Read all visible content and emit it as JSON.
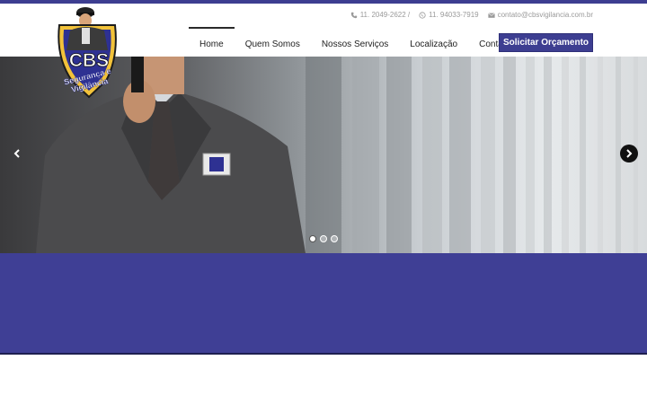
{
  "logo": {
    "brand": "CBS",
    "tagline_1": "Segurança e",
    "tagline_2": "Vigilância"
  },
  "contact": {
    "phone_icon": "phone-icon",
    "phone": "11. 2049-2622 /",
    "whatsapp_icon": "whatsapp-icon",
    "whatsapp": "11. 94033-7919",
    "email_icon": "envelope-icon",
    "email": "contato@cbsvigilancia.com.br"
  },
  "nav": {
    "items": [
      {
        "label": "Home",
        "active": true
      },
      {
        "label": "Quem Somos",
        "active": false
      },
      {
        "label": "Nossos Serviços",
        "active": false
      },
      {
        "label": "Localização",
        "active": false
      },
      {
        "label": "Contato",
        "active": false
      }
    ]
  },
  "cta": {
    "label": "Solicitar Orçamento"
  },
  "hero": {
    "prev_icon": "chevron-left-icon",
    "next_icon": "chevron-right-icon",
    "slide_count": 3,
    "active_slide": 1
  },
  "colors": {
    "brand": "#3d3e91",
    "band": "#3f3f95",
    "muted_text": "#9a9a9a"
  }
}
